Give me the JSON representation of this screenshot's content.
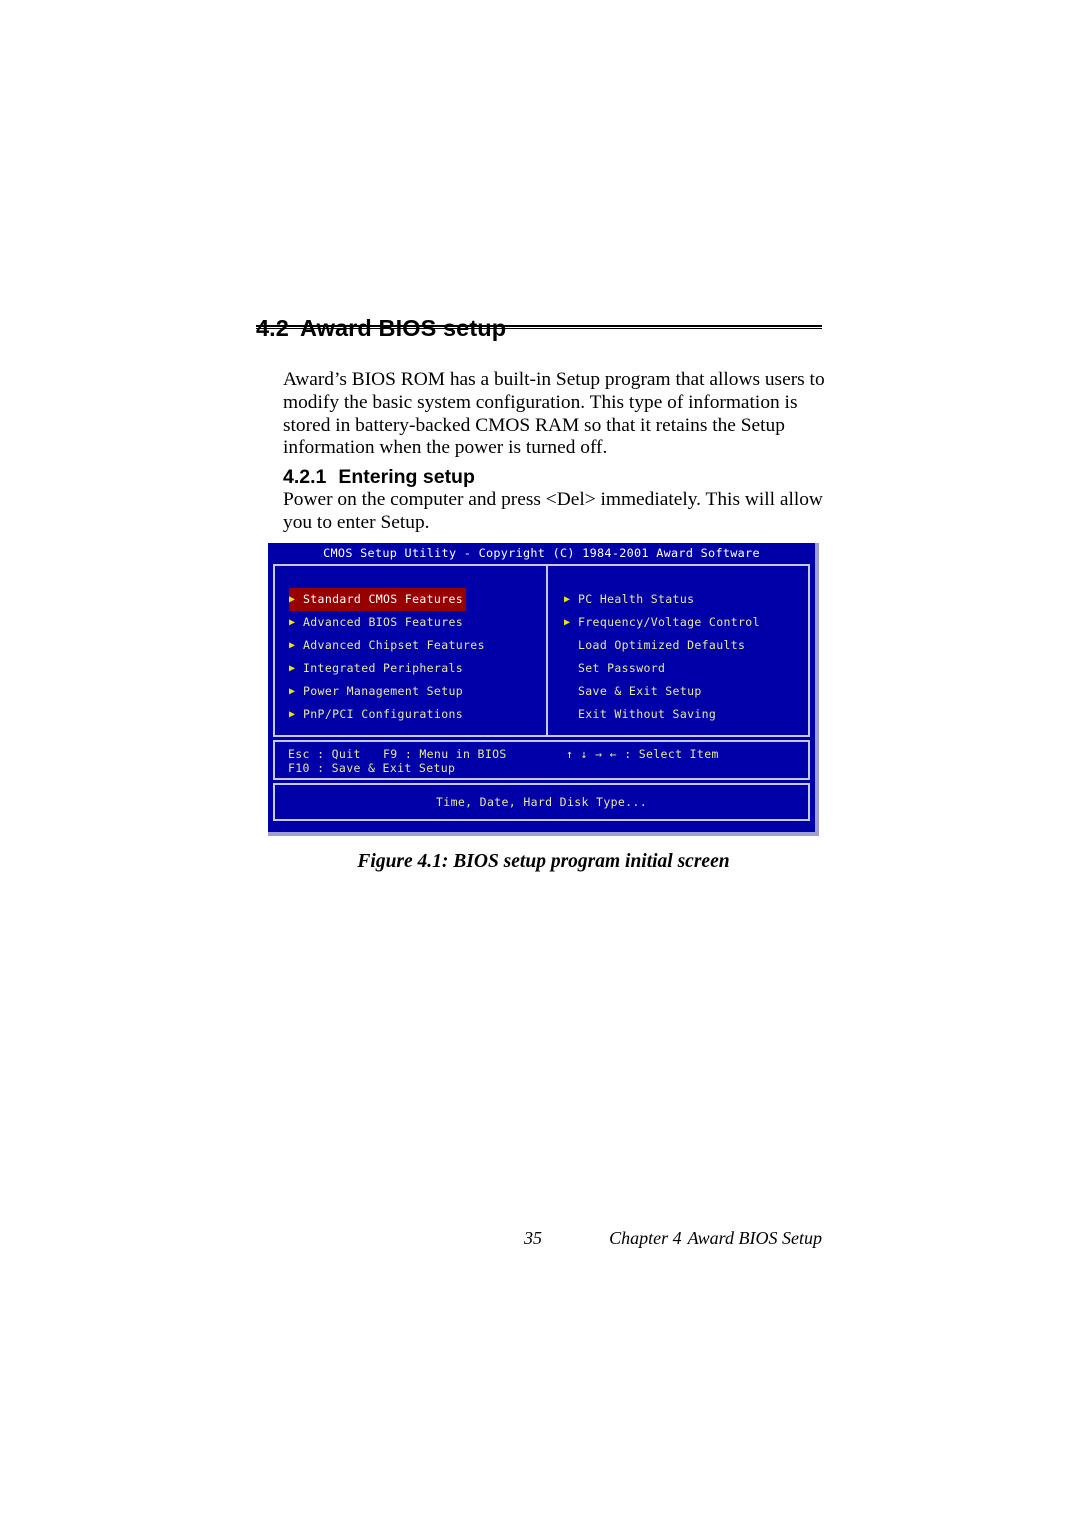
{
  "document": {
    "section": {
      "number": "4.2",
      "title": "Award BIOS setup"
    },
    "intro_paragraph": "Award’s BIOS ROM has a built-in Setup program that allows users to modify the basic system configuration. This type of information is stored in battery-backed CMOS RAM so that it retains the Setup information when the power is turned off.",
    "subsection": {
      "number": "4.2.1",
      "title": "Entering setup"
    },
    "entering_paragraph": "Power on the computer and press <Del> immediately. This will allow you to enter Setup.",
    "figure_caption": "Figure 4.1: BIOS setup program initial screen",
    "footer": {
      "page_number": "35",
      "chapter_label": "Chapter 4",
      "chapter_title": "Award BIOS Setup"
    }
  },
  "bios": {
    "title": "CMOS Setup Utility - Copyright (C) 1984-2001 Award Software",
    "arrow_glyph": "▶",
    "left_menu": [
      {
        "label": "Standard CMOS Features",
        "has_arrow": true,
        "selected": true
      },
      {
        "label": "Advanced BIOS Features",
        "has_arrow": true,
        "selected": false
      },
      {
        "label": "Advanced Chipset Features",
        "has_arrow": true,
        "selected": false
      },
      {
        "label": "Integrated Peripherals",
        "has_arrow": true,
        "selected": false
      },
      {
        "label": "Power Management Setup",
        "has_arrow": true,
        "selected": false
      },
      {
        "label": "PnP/PCI Configurations",
        "has_arrow": true,
        "selected": false
      }
    ],
    "right_menu": [
      {
        "label": "PC Health Status",
        "has_arrow": true,
        "selected": false
      },
      {
        "label": "Frequency/Voltage Control",
        "has_arrow": true,
        "selected": false
      },
      {
        "label": "Load Optimized Defaults",
        "has_arrow": false,
        "selected": false
      },
      {
        "label": "Set Password",
        "has_arrow": false,
        "selected": false
      },
      {
        "label": "Save & Exit Setup",
        "has_arrow": false,
        "selected": false
      },
      {
        "label": "Exit Without Saving",
        "has_arrow": false,
        "selected": false
      }
    ],
    "help": {
      "esc": "Esc : Quit",
      "f9": "F9 : Menu in BIOS",
      "select": "↑ ↓ → ←   : Select Item",
      "f10": "F10 : Save & Exit Setup"
    },
    "status_line": "Time, Date, Hard Disk Type...",
    "colors": {
      "background": "#0000a8",
      "border": "#c8c8e8",
      "text": "#e8e8a0",
      "title_text": "#ffffff",
      "arrow": "#e8e800",
      "selected_background": "#980000",
      "selected_text": "#ffffff"
    }
  }
}
